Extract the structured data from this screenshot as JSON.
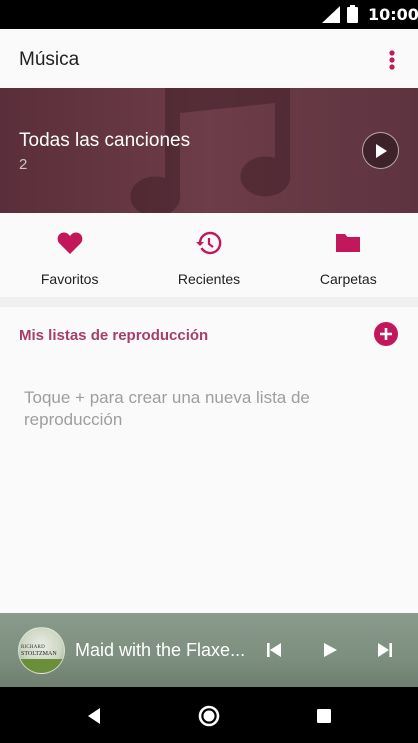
{
  "status_bar": {
    "time": "10:00"
  },
  "app_bar": {
    "title": "Música"
  },
  "hero": {
    "label": "Todas las canciones",
    "count": "2"
  },
  "quick": [
    {
      "label": "Favoritos",
      "icon": "heart-icon"
    },
    {
      "label": "Recientes",
      "icon": "history-icon"
    },
    {
      "label": "Carpetas",
      "icon": "folder-icon"
    }
  ],
  "playlists": {
    "title": "Mis listas de reproducción",
    "hint": "Toque + para crear una nueva lista de reproducción"
  },
  "player": {
    "track": "Maid with the Flaxe...",
    "cover_line1": "RICHARD",
    "cover_line2": "STOLTZMAN"
  },
  "colors": {
    "accent": "#c2185b",
    "section_title": "#a83d6c",
    "hint": "#9e9e9e"
  }
}
